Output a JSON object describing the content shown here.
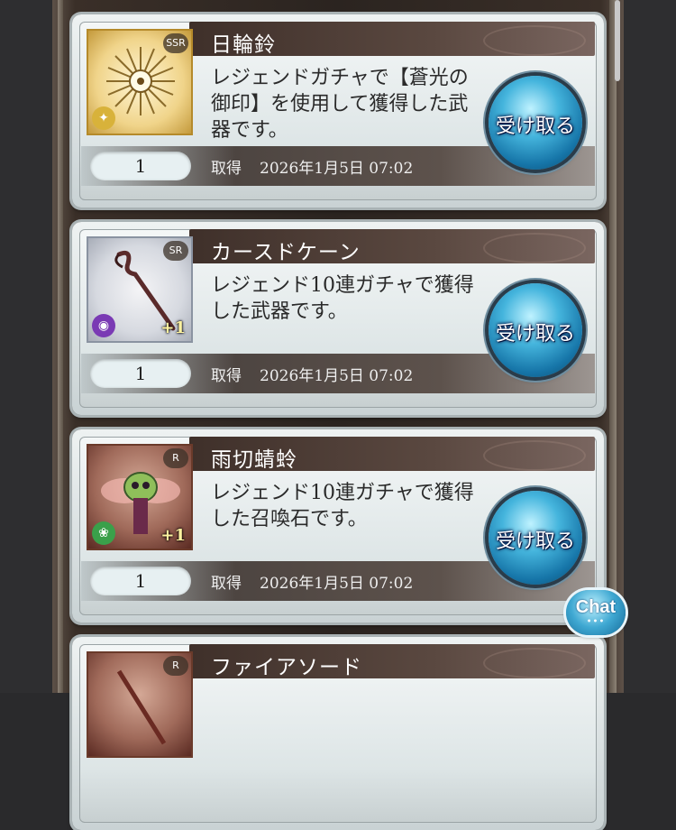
{
  "items": [
    {
      "name": "日輪鈴",
      "description": "レジェンドガチャで【蒼光の御印】を使用して獲得した武器です。",
      "rarity": "SSR",
      "element_icon": "light-element-icon",
      "item_icon": "sun-bell-icon",
      "plus": "",
      "quantity": "1",
      "acquired_label": "取得",
      "acquired_date": "2026年1月5日 07:02",
      "receive_label": "受け取る"
    },
    {
      "name": "カースドケーン",
      "description": "レジェンド10連ガチャで獲得した武器です。",
      "rarity": "SR",
      "element_icon": "dark-element-icon",
      "item_icon": "cane-icon",
      "plus": "+1",
      "quantity": "1",
      "acquired_label": "取得",
      "acquired_date": "2026年1月5日 07:02",
      "receive_label": "受け取る"
    },
    {
      "name": "雨切蜻蛉",
      "description": "レジェンド10連ガチャで獲得した召喚石です。",
      "rarity": "R",
      "element_icon": "wind-element-icon",
      "item_icon": "dragonfly-summon-icon",
      "plus": "+1",
      "quantity": "1",
      "acquired_label": "取得",
      "acquired_date": "2026年1月5日 07:02",
      "receive_label": "受け取る"
    },
    {
      "name": "ファイアソード",
      "description": "",
      "rarity": "R",
      "element_icon": "",
      "item_icon": "sword-icon",
      "plus": "",
      "quantity": "",
      "acquired_label": "",
      "acquired_date": "",
      "receive_label": ""
    }
  ],
  "chat": {
    "label": "Chat",
    "dots": "•••"
  },
  "colors": {
    "button_blue": "#1675a8",
    "title_bar": "#3f302a",
    "panel": "#e6ecec"
  }
}
